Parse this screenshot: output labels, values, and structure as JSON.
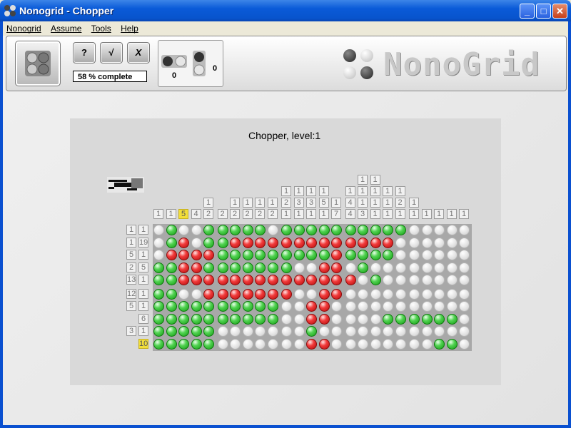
{
  "window": {
    "title": "Nonogrid - Chopper"
  },
  "menu": [
    "Nonogrid",
    "Assume",
    "Tools",
    "Help"
  ],
  "toolbar": {
    "hint_label": "?",
    "check_label": "√",
    "cancel_label": "X",
    "progress_text": "58 % complete",
    "count_left": "0",
    "count_right": "0",
    "logo_text": "NonoGrid"
  },
  "puzzle": {
    "title": "Chopper, level:1",
    "column_clues": [
      [
        "1"
      ],
      [
        "1"
      ],
      [
        "5"
      ],
      [
        "4"
      ],
      [
        "1",
        "2"
      ],
      [
        "2"
      ],
      [
        "1",
        "2"
      ],
      [
        "1",
        "2"
      ],
      [
        "1",
        "2"
      ],
      [
        "1",
        "2"
      ],
      [
        "1",
        "2",
        "1"
      ],
      [
        "1",
        "3",
        "1"
      ],
      [
        "1",
        "3",
        "1"
      ],
      [
        "1",
        "5",
        "1"
      ],
      [
        "1",
        "7"
      ],
      [
        "1",
        "4",
        "4"
      ],
      [
        "1",
        "1",
        "1",
        "3"
      ],
      [
        "1",
        "1",
        "1",
        "1"
      ],
      [
        "1",
        "1",
        "1"
      ],
      [
        "1",
        "2",
        "1"
      ],
      [
        "1",
        "1"
      ],
      [
        "1"
      ],
      [
        "1"
      ],
      [
        "1"
      ],
      [
        "1"
      ]
    ],
    "highlight_col": 2,
    "row_clues": [
      [
        "1",
        "1"
      ],
      [
        "1",
        "19"
      ],
      [
        "5",
        "1"
      ],
      [
        "2",
        "5"
      ],
      [
        "13",
        "1"
      ],
      [
        "12",
        "1"
      ],
      [
        "5",
        "1"
      ],
      [
        "6"
      ],
      [
        "3",
        "1"
      ],
      [
        "10"
      ]
    ],
    "highlight_row": 9,
    "grid": [
      "egeegggggeggggggggggeeeee",
      "egreggrrrrrrrrrrrrreeeee",
      "errrrgggggggggrggggeeeeee",
      "ggrrgggggggeerregeeeeeeee",
      "ggrrrrrrrrrrrrrregeeeeeeee",
      "ggeerrrrrrreerreeeeeeeeee",
      "ggggggggggeerreeeeeeeeeee",
      "ggggggggggeerreeeegggggg",
      "gggggeeeeeeegeeeeeeeeeeee",
      "gggggeeeeeeerreeeeeeeeggee"
    ]
  }
}
